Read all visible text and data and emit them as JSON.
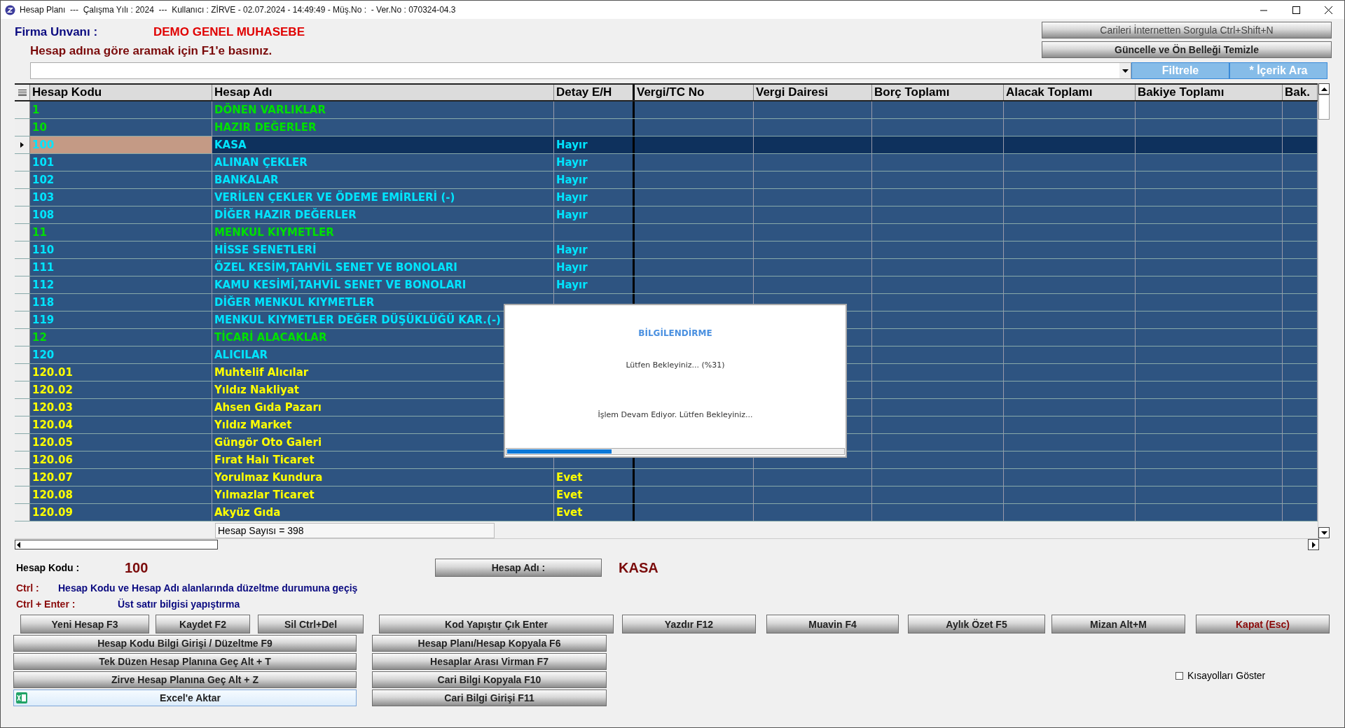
{
  "window": {
    "title": "Hesap Planı  ---  Çalışma Yılı : 2024  ---  Kullanıcı : ZİRVE - 02.07.2024 - 14:49:49 - Müş.No :  - Ver.No : 070324-04.3"
  },
  "company": {
    "label": "Firma Unvanı :",
    "value": "DEMO GENEL MUHASEBE"
  },
  "top_buttons": [
    "Carileri İnternetten Sorgula Ctrl+Shift+N",
    "Güncelle ve Ön Belleği Temizle"
  ],
  "search_hint": "Hesap adına göre aramak için F1'e basınız.",
  "filter_buttons": [
    "Filtrele",
    "* İçerik Ara"
  ],
  "table": {
    "columns": [
      "Hesap Kodu",
      "Hesap Adı",
      "Detay E/H",
      "Vergi/TC No",
      "Vergi Dairesi",
      "Borç Toplamı",
      "Alacak Toplamı",
      "Bakiye Toplamı",
      "Bak."
    ],
    "rows": [
      {
        "code": "1",
        "name": "DÖNEN VARLIKLAR",
        "kind": "group",
        "selected": false
      },
      {
        "code": "10",
        "name": "HAZIR DEĞERLER",
        "kind": "group",
        "selected": false
      },
      {
        "code": "100",
        "name": "KASA",
        "detay": "Hayır",
        "kind": "account",
        "selected": true
      },
      {
        "code": "101",
        "name": "ALINAN ÇEKLER",
        "detay": "Hayır",
        "kind": "account",
        "selected": false
      },
      {
        "code": "102",
        "name": "BANKALAR",
        "detay": "Hayır",
        "kind": "account",
        "selected": false
      },
      {
        "code": "103",
        "name": "VERİLEN ÇEKLER VE ÖDEME EMİRLERİ (-)",
        "detay": "Hayır",
        "kind": "account",
        "selected": false
      },
      {
        "code": "108",
        "name": "DİĞER HAZIR DEĞERLER",
        "detay": "Hayır",
        "kind": "account",
        "selected": false
      },
      {
        "code": "11",
        "name": "MENKUL KIYMETLER",
        "kind": "group",
        "selected": false
      },
      {
        "code": "110",
        "name": "HİSSE SENETLERİ",
        "detay": "Hayır",
        "kind": "account",
        "selected": false
      },
      {
        "code": "111",
        "name": "ÖZEL KESİM,TAHVİL SENET VE BONOLARI",
        "detay": "Hayır",
        "kind": "account",
        "selected": false
      },
      {
        "code": "112",
        "name": "KAMU KESİMİ,TAHVİL SENET VE BONOLARI",
        "detay": "Hayır",
        "kind": "account",
        "selected": false
      },
      {
        "code": "118",
        "name": "DİĞER MENKUL KIYMETLER",
        "kind": "account",
        "selected": false
      },
      {
        "code": "119",
        "name": "MENKUL KIYMETLER DEĞER DÜŞÜKLÜĞÜ KAR.(-)",
        "kind": "account",
        "selected": false
      },
      {
        "code": "12",
        "name": "TİCARİ ALACAKLAR",
        "kind": "group",
        "selected": false
      },
      {
        "code": "120",
        "name": "ALICILAR",
        "kind": "account",
        "selected": false
      },
      {
        "code": "120.01",
        "name": "Muhtelif Alıcılar",
        "kind": "sub",
        "selected": false
      },
      {
        "code": "120.02",
        "name": "Yıldız Nakliyat",
        "kind": "sub",
        "selected": false
      },
      {
        "code": "120.03",
        "name": "Ahsen Gıda Pazarı",
        "kind": "sub",
        "selected": false
      },
      {
        "code": "120.04",
        "name": "Yıldız Market",
        "kind": "sub",
        "selected": false
      },
      {
        "code": "120.05",
        "name": "Güngör Oto Galeri",
        "kind": "sub",
        "selected": false
      },
      {
        "code": "120.06",
        "name": "Fırat Halı Ticaret",
        "kind": "sub",
        "selected": false
      },
      {
        "code": "120.07",
        "name": "Yorulmaz Kundura",
        "detay": "Evet",
        "kind": "sub",
        "selected": false
      },
      {
        "code": "120.08",
        "name": "Yılmazlar Ticaret",
        "detay": "Evet",
        "kind": "sub",
        "selected": false
      },
      {
        "code": "120.09",
        "name": "Akyüz Gıda",
        "detay": "Evet",
        "kind": "sub",
        "selected": false
      }
    ],
    "footer": "Hesap Sayısı = 398"
  },
  "dialog": {
    "title": "BİLGİLENDİRME",
    "message": "Lütfen Bekleyiniz... (%31)",
    "status": "İşlem Devam Ediyor. Lütfen Bekleyiniz...",
    "level": 0.31
  },
  "details": {
    "code_label": "Hesap Kodu :",
    "code_value": "100",
    "name_button": "Hesap Adı :",
    "name_value": "KASA"
  },
  "shortcuts": [
    {
      "key": "Ctrl :",
      "text": "Hesap Kodu ve Hesap Adı alanlarında düzeltme durumuna geçiş"
    },
    {
      "key": "Ctrl + Enter :",
      "text": "Üst satır bilgisi yapıştırma"
    }
  ],
  "toolbar": [
    {
      "label": "Yeni Hesap F3",
      "kind": "normal"
    },
    {
      "label": "Kaydet F2",
      "kind": "normal"
    },
    {
      "label": "Sil Ctrl+Del",
      "kind": "normal"
    },
    {
      "label": "Kod Yapıştır Çık Enter",
      "kind": "normal"
    },
    {
      "label": "Yazdır F12",
      "kind": "normal"
    },
    {
      "label": "Muavin F4",
      "kind": "normal"
    },
    {
      "label": "Aylık Özet F5",
      "kind": "normal"
    },
    {
      "label": "Mizan Alt+M",
      "kind": "normal"
    },
    {
      "label": "Kapat (Esc)",
      "kind": "close"
    }
  ],
  "left_buttons": [
    {
      "label": "Hesap Kodu Bilgi Girişi / Düzeltme F9",
      "kind": "normal"
    },
    {
      "label": "Tek Düzen Hesap Planına Geç Alt + T",
      "kind": "normal"
    },
    {
      "label": "Zirve Hesap Planına Geç Alt + Z",
      "kind": "normal"
    },
    {
      "label": "Excel'e Aktar",
      "kind": "excel"
    }
  ],
  "middle_buttons": [
    "Hesap Planı/Hesap Kopyala F6",
    "Hesaplar Arası Virman F7",
    "Cari Bilgi Kopyala F10",
    "Cari Bilgi Girişi F11"
  ],
  "show_shortcuts": {
    "label": "Kısayolları Göster",
    "checked": false
  }
}
